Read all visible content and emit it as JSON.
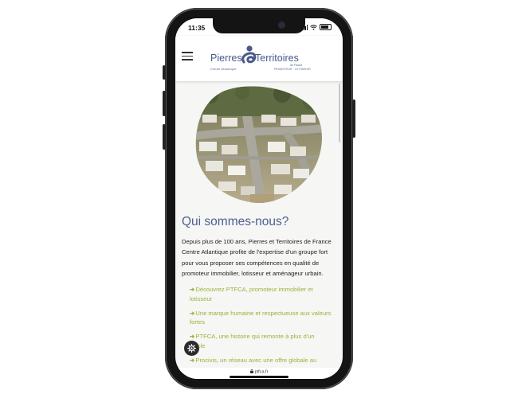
{
  "status_bar": {
    "time": "11:35"
  },
  "header": {
    "logo_word_left": "Pierres",
    "logo_word_right": "Territoires",
    "logo_sub_region": "Centre Atlantique",
    "logo_sub_tagline": "PROMOTEUR · LOTISSEUR",
    "logo_sub_france": "de France",
    "brand_color": "#4a5a8a"
  },
  "main": {
    "title": "Qui sommes-nous?",
    "paragraph": "Depuis plus de 100 ans, Pierres et Territoires de France Centre Atlantique profite de l'expertise d'un groupe fort pour vous proposer ses compétences en qualité de promoteur immobilier, lotisseur et aménageur urbain.",
    "link_arrow": "➔",
    "links": [
      "Découvrez PTFCA, promoteur immobilier et lotisseur",
      "Une marque humaine et respectueuse aux valeurs fortes",
      "PTFCA, une histoire qui remonte à plus d'un siècle",
      "Procivis, un réseau avec une offre globale au"
    ],
    "title_color": "#4c6191",
    "link_color": "#97b43b"
  },
  "browser": {
    "url": "ptfca.fr"
  },
  "icons": {
    "menu": "hamburger-icon",
    "settings": "gear-icon",
    "lock": "lock-icon"
  }
}
